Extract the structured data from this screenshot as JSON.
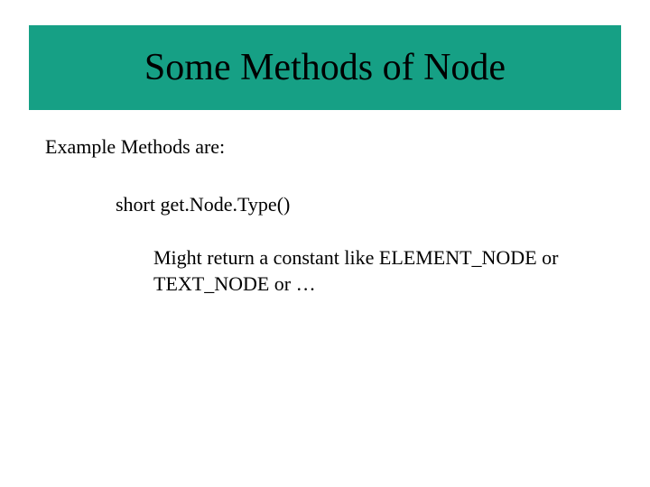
{
  "title": "Some Methods of Node",
  "subtitle": "Example Methods are:",
  "method_signature": "short get.Node.Type()",
  "description": " Might return a constant like ELEMENT_NODE or TEXT_NODE or …"
}
